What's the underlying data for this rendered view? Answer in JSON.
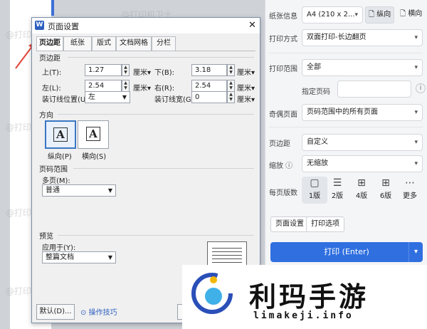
{
  "dialog": {
    "title": "页面设置",
    "icon_letter": "W",
    "close": "✕",
    "tabs": [
      "页边距",
      "纸张",
      "版式",
      "文档网格",
      "分栏"
    ],
    "margins": {
      "group": "页边距",
      "top_label": "上(T):",
      "top_value": "1.27",
      "bottom_label": "下(B):",
      "bottom_value": "3.18",
      "left_label": "左(L):",
      "left_value": "2.54",
      "right_label": "右(R):",
      "right_value": "2.54",
      "gutter_pos_label": "装订线位置(U):",
      "gutter_pos_value": "左",
      "gutter_width_label": "装订线宽(G):",
      "gutter_width_value": "0",
      "unit": "厘米▾"
    },
    "orientation": {
      "group": "方向",
      "portrait": "纵向(P)",
      "landscape": "横向(S)",
      "glyph": "A"
    },
    "pages": {
      "group": "页码范围",
      "multi_label": "多页(M):",
      "multi_value": "普通"
    },
    "preview": {
      "group": "预览",
      "apply_label": "应用于(Y):",
      "apply_value": "整篇文档"
    },
    "default_button": "默认(D)...",
    "tips_link": "操作技巧"
  },
  "panel": {
    "paper_label": "纸张信息",
    "paper_value": "A4 (210 x 2...",
    "portrait": "纵向",
    "landscape": "横向",
    "mode_label": "打印方式",
    "mode_value": "双面打印-长边翻页",
    "range_label": "打印范围",
    "range_value": "全部",
    "pages_label": "指定页码",
    "oddeven_label": "奇偶页面",
    "oddeven_value": "页码范围中的所有页面",
    "margin_label": "页边距",
    "margin_value": "自定义",
    "scale_label": "缩放 ⓘ",
    "scale_value": "无缩放",
    "pps_label": "每页版数",
    "pps_options": [
      "1版",
      "2版",
      "4版",
      "6版",
      "更多"
    ],
    "setup_button": "页面设置",
    "options_button": "打印选项",
    "print_button": "打印 (Enter)"
  },
  "watermark": "@打印机卫士",
  "logo": {
    "text": "利玛手游",
    "url": "limakeji.info"
  },
  "colors": {
    "accent": "#2f6fe0",
    "arrow": "#e0463a"
  }
}
